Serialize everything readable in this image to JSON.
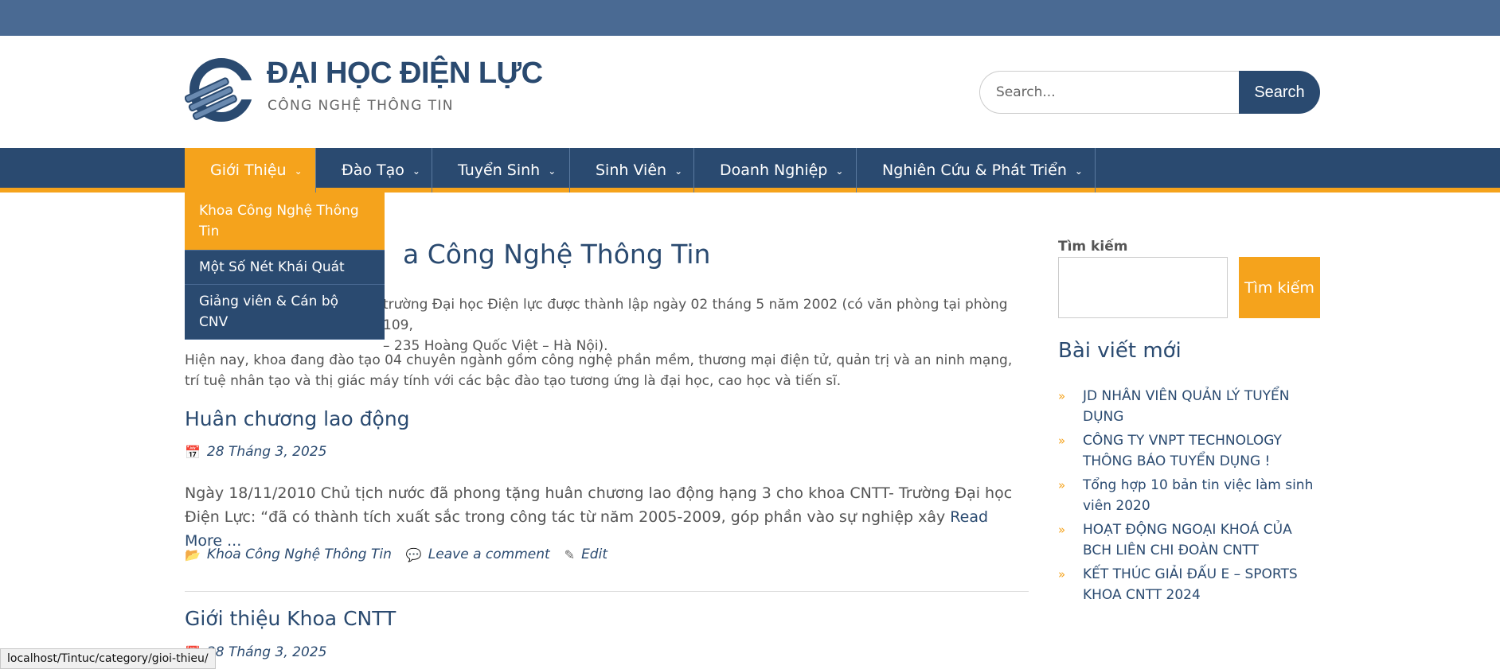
{
  "header": {
    "site_title": "ĐẠI HỌC ĐIỆN LỰC",
    "site_subtitle": "CÔNG NGHỆ THÔNG TIN",
    "search_placeholder": "Search...",
    "search_button": "Search"
  },
  "nav": {
    "items": [
      {
        "label": "Giới Thiệu",
        "active": true
      },
      {
        "label": "Đào Tạo"
      },
      {
        "label": "Tuyển Sinh"
      },
      {
        "label": "Sinh Viên"
      },
      {
        "label": "Doanh Nghiệp"
      },
      {
        "label": "Nghiên Cứu & Phát Triển"
      }
    ],
    "dropdown": [
      "Khoa Công Nghệ Thông Tin",
      "Một Số Nét Khái Quát",
      "Giảng viên & Cán bộ CNV"
    ]
  },
  "main": {
    "page_title_visible": "a Công Nghệ Thông Tin",
    "intro_p1_line1": "trường Đại học Điện lực được thành lập ngày 02 tháng 5 năm 2002 (có văn phòng tại phòng 109,",
    "intro_p1_line2": "– 235 Hoàng Quốc Việt – Hà Nội).",
    "intro_p2": "Hiện nay, khoa đang đào tạo 04 chuyên ngành gồm công nghệ phần mềm, thương mại điện tử, quản trị và an ninh mạng, trí tuệ nhân tạo và thị giác máy tính với các bậc đào tạo tương ứng là đại học, cao học và tiến sĩ.",
    "posts": [
      {
        "title": "Huân chương lao động",
        "date": "28 Tháng 3, 2025",
        "excerpt": "Ngày 18/11/2010 Chủ tịch nước đã phong tặng huân chương lao động hạng 3 cho khoa CNTT- Trường Đại học Điện Lực: “đã có thành tích xuất sắc trong công tác từ năm 2005-2009, góp phần vào sự nghiệp xây",
        "read_more": "Read More ...",
        "category": "Khoa Công Nghệ Thông Tin",
        "comment": "Leave a comment",
        "edit": "Edit"
      },
      {
        "title": "Giới thiệu Khoa CNTT",
        "date": "28 Tháng 3, 2025"
      }
    ]
  },
  "sidebar": {
    "search_label": "Tìm kiếm",
    "search_button": "Tìm kiếm",
    "recent_heading": "Bài viết mới",
    "recent_posts": [
      "JD NHÂN VIÊN QUẢN LÝ TUYỂN DỤNG",
      "CÔNG TY VNPT TECHNOLOGY THÔNG BÁO TUYỂN DỤNG !",
      "Tổng hợp 10 bản tin việc làm sinh viên 2020",
      "HOẠT ĐỘNG NGOẠI KHOÁ CỦA BCH LIÊN CHI ĐOÀN CNTT",
      "KẾT THÚC GIẢI ĐẤU E – SPORTS KHOA CNTT 2024"
    ]
  },
  "status_url": "localhost/Tintuc/category/gioi-thieu/",
  "colors": {
    "topbar": "#4a6a93",
    "primary": "#2a4a70",
    "accent": "#f5a31c"
  },
  "icons": [
    "logo-emblem",
    "chevron-down-icon",
    "calendar-icon",
    "folder-icon",
    "comment-icon",
    "edit-icon",
    "double-chevron-right-icon"
  ]
}
